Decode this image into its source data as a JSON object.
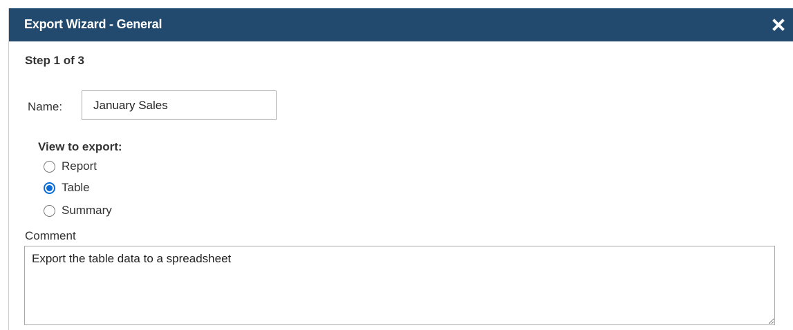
{
  "dialog": {
    "title": "Export Wizard - General",
    "close_icon": "close-icon",
    "step": "Step 1 of 3"
  },
  "form": {
    "name_label": "Name:",
    "name_value": "January Sales",
    "view_label": "View to export:",
    "view_options": [
      {
        "label": "Report",
        "selected": false
      },
      {
        "label": "Table",
        "selected": true
      },
      {
        "label": "Summary",
        "selected": false
      }
    ],
    "comment_label": "Comment",
    "comment_value": "Export the table data to a spreadsheet"
  },
  "colors": {
    "titlebar": "#214a6e",
    "radio_accent": "#0b6bd8"
  }
}
